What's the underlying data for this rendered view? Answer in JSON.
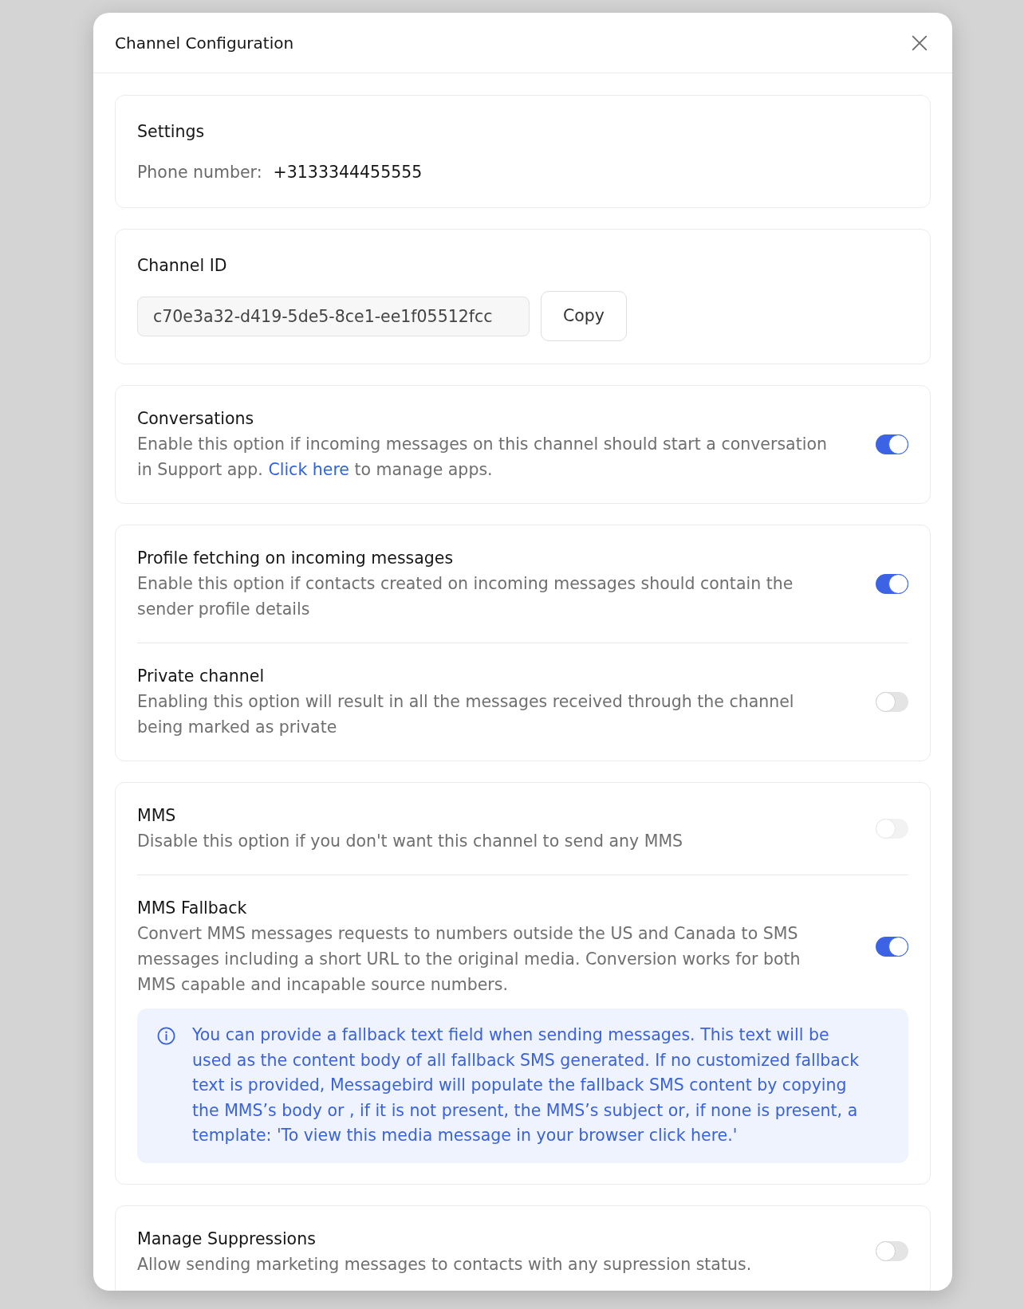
{
  "dialog": {
    "title": "Channel Configuration"
  },
  "settings": {
    "title": "Settings",
    "phone_label": "Phone number:",
    "phone_value": "+3133344455555"
  },
  "channel_id": {
    "title": "Channel ID",
    "value": "c70e3a32-d419-5de5-8ce1-ee1f05512fcc",
    "button": "Copy"
  },
  "sections": [
    {
      "options": [
        {
          "title": "Conversations",
          "description": "Enable this option if incoming messages on this channel should start a conversation in Support app.",
          "link": "Click here",
          "description_after": "to manage apps.",
          "on": true,
          "disabled": false
        }
      ]
    },
    {
      "options": [
        {
          "title": "Profile fetching on incoming messages",
          "description": "Enable this option if contacts created on incoming messages should contain the sender profile details",
          "on": true,
          "disabled": false
        },
        {
          "title": "Private channel",
          "description": "Enabling this option will result in all the messages received through the channel being marked as private",
          "on": false,
          "disabled": false
        }
      ]
    },
    {
      "options": [
        {
          "title": "MMS",
          "description": "Disable this option if you don't want this channel to send any MMS",
          "on": false,
          "disabled": true
        },
        {
          "title": "MMS Fallback",
          "description": "Convert MMS messages requests to numbers outside the US and Canada to SMS messages including a short URL to the original media. Conversion works for both MMS capable and incapable source numbers.",
          "on": true,
          "disabled": false,
          "note": "You can provide a fallback text field when sending messages. This text will be used as the content body of all fallback SMS generated. If no customized fallback text is provided, Messagebird will populate the fallback SMS content by copying the MMS’s body or , if it is not present, the MMS’s subject or, if none is present, a template: 'To view this media message in your browser click here.'"
        }
      ]
    },
    {
      "options": [
        {
          "title": "Manage Suppressions",
          "description": "Allow sending marketing messages to contacts with any supression status.",
          "on": false,
          "disabled": false
        }
      ]
    }
  ]
}
